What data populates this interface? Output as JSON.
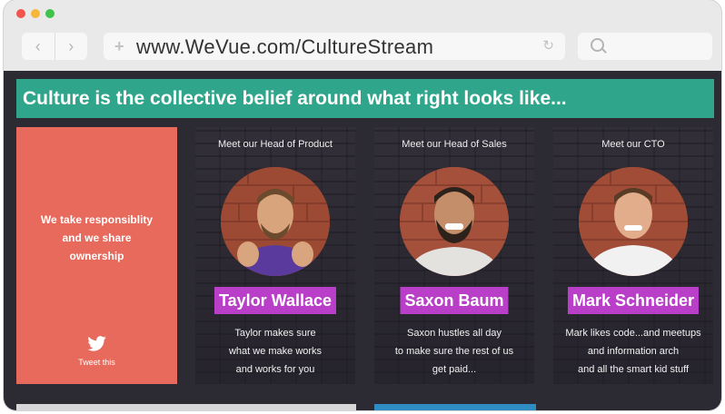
{
  "browser": {
    "url": "www.WeVue.com/CultureStream"
  },
  "page": {
    "headline": "Culture is the collective belief around what right looks like...",
    "value_card": {
      "lines": [
        "We take responsiblity",
        "and we share",
        "ownership"
      ],
      "tweet_label": "Tweet this",
      "icon": "twitter-bird-icon"
    },
    "people": [
      {
        "role": "Meet our Head of Product",
        "name": "Taylor Wallace",
        "bio": [
          "Taylor makes sure",
          "what we make works",
          "and works for you"
        ]
      },
      {
        "role": "Meet our Head of Sales",
        "name": "Saxon Baum",
        "bio": [
          "Saxon hustles all day",
          "to make sure the rest of us",
          "get paid..."
        ]
      },
      {
        "role": "Meet our CTO",
        "name": "Mark Schneider",
        "bio": [
          "Mark likes code...and meetups",
          "and information arch",
          "and all the smart kid stuff"
        ]
      }
    ]
  },
  "colors": {
    "headline_bg": "#2fa58b",
    "value_card_bg": "#e86a5c",
    "name_badge_bg": "#b93fc8",
    "content_bg": "#2c2b34"
  }
}
